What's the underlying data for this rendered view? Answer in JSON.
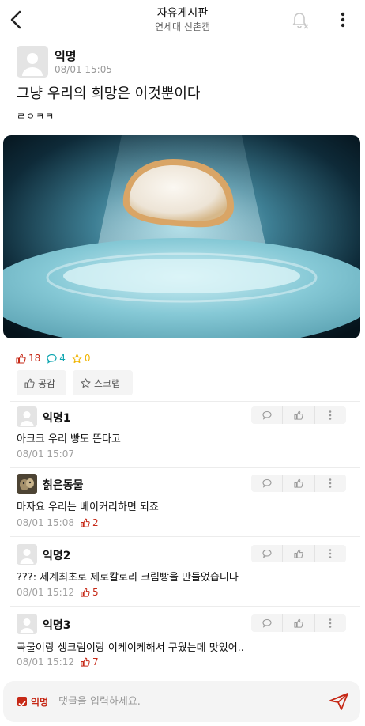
{
  "header": {
    "title": "자유게시판",
    "subtitle": "연세대 신촌캠",
    "back_icon": "chevron-left-icon",
    "bell_icon": "bell-off-icon",
    "more_icon": "more-vertical-icon"
  },
  "post": {
    "author": "익명",
    "date": "08/01 15:05",
    "title": "그냥 우리의 희망은 이것뿐이다",
    "body": "ㄹㅇㅋㅋ",
    "stats": {
      "likes": "18",
      "comments": "4",
      "scraps": "0"
    },
    "like_button": "공감",
    "scrap_button": "스크랩"
  },
  "comments": [
    {
      "name": "익명1",
      "text": "아크크 우리 빵도 뜬다고",
      "date": "08/01 15:07",
      "likes": ""
    },
    {
      "name": "칡은동물",
      "text": "마자요 우리는 베이커리하면 되죠",
      "date": "08/01 15:08",
      "likes": "2"
    },
    {
      "name": "익명2",
      "text": "???: 세계최초로 제로칼로리 크림빵을 만들었습니다",
      "date": "08/01 15:12",
      "likes": "5"
    },
    {
      "name": "익명3",
      "text": "곡물이랑 생크림이랑 이케이케해서 구웠는데 맛있어..",
      "date": "08/01 15:12",
      "likes": "7"
    }
  ],
  "composer": {
    "anonymous_label": "익명",
    "placeholder": "댓글을 입력하세요."
  },
  "colors": {
    "accent": "#c62917",
    "comment_teal": "#0ca5b0",
    "scrap_yellow": "#f0b400"
  }
}
